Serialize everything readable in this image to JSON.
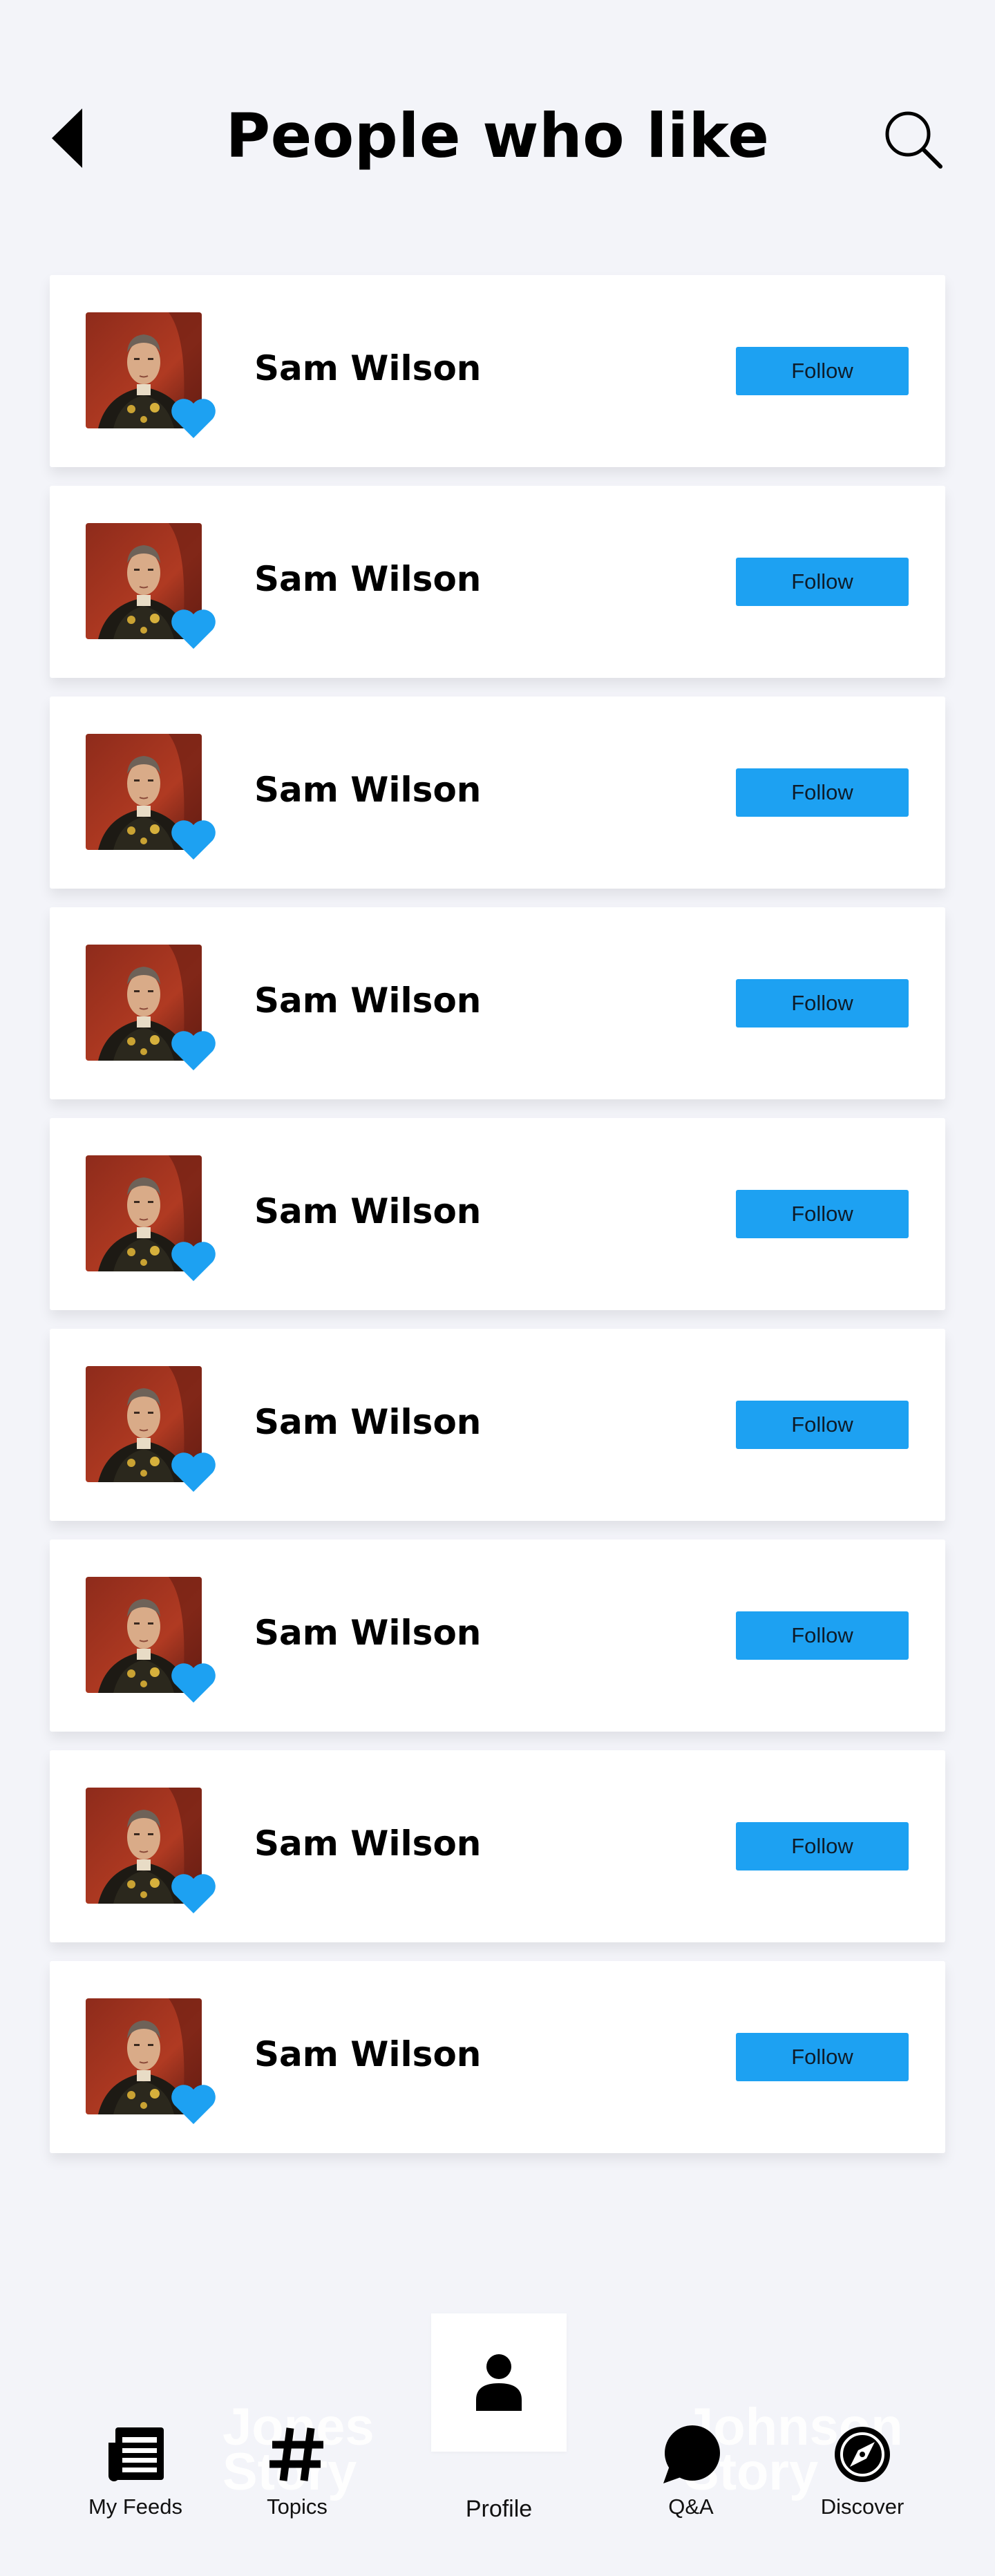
{
  "header": {
    "title": "People who like",
    "back_icon": "back-arrow-icon",
    "search_icon": "search-icon"
  },
  "colors": {
    "background": "#f3f4f9",
    "accent": "#1da1f2",
    "card": "#ffffff"
  },
  "people": [
    {
      "name": "Sam Wilson",
      "follow_label": "Follow"
    },
    {
      "name": "Sam Wilson",
      "follow_label": "Follow"
    },
    {
      "name": "Sam Wilson",
      "follow_label": "Follow"
    },
    {
      "name": "Sam Wilson",
      "follow_label": "Follow"
    },
    {
      "name": "Sam Wilson",
      "follow_label": "Follow"
    },
    {
      "name": "Sam Wilson",
      "follow_label": "Follow"
    },
    {
      "name": "Sam Wilson",
      "follow_label": "Follow"
    },
    {
      "name": "Sam Wilson",
      "follow_label": "Follow"
    },
    {
      "name": "Sam Wilson",
      "follow_label": "Follow"
    }
  ],
  "bottom_nav": {
    "items": [
      {
        "label": "My Feeds",
        "icon": "news-feed-icon"
      },
      {
        "label": "Topics",
        "icon": "hashtag-icon"
      },
      {
        "label": "Profile",
        "icon": "person-icon"
      },
      {
        "label": "Q&A",
        "icon": "chat-bubble-icon"
      },
      {
        "label": "Discover",
        "icon": "compass-icon"
      }
    ],
    "watermark_left": "Jones Story",
    "watermark_right": "Johnson Story"
  }
}
